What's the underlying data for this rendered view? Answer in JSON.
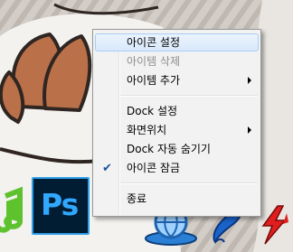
{
  "desktop": {
    "dock_icons": [
      "music-app-icon",
      "photoshop-icon",
      "globe-app-icon",
      "brush-app-icon",
      "flash-icon"
    ],
    "photoshop_label": "Ps"
  },
  "context_menu": {
    "items": [
      {
        "label": "아이콘 설정",
        "state": "highlighted"
      },
      {
        "label": "아이템 삭제",
        "state": "disabled"
      },
      {
        "label": "아이템 추가",
        "has_submenu": true
      },
      {
        "label": "Dock 설정"
      },
      {
        "label": "화면위치",
        "has_submenu": true
      },
      {
        "label": "Dock 자동 숨기기"
      },
      {
        "label": "아이콘 잠금",
        "checked": true
      },
      {
        "label": "종료"
      }
    ]
  },
  "colors": {
    "menu_background": "#f2f2f2",
    "highlight_border": "#a8cdf4",
    "disabled_text": "#8d8d8d",
    "check_color": "#1c4f9c",
    "photoshop_blue": "#31a8ff"
  }
}
